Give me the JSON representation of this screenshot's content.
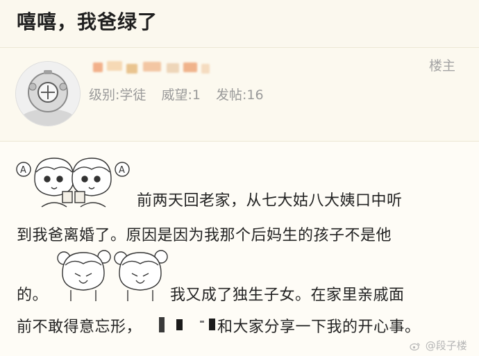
{
  "post": {
    "title": "嘻嘻，我爸绿了"
  },
  "author": {
    "level_label": "级别:学徒",
    "prestige_label": "威望:1",
    "posts_label": "发帖:16",
    "role_badge": "楼主",
    "extra": "-"
  },
  "content": {
    "line1": "前两天回老家，从七大姑八大姨口中听",
    "line2": "到我爸离婚了。原因是因为我那个后妈生的孩子不是他",
    "line3_start": "的。",
    "line3_end": "我又成了独生子女。在家里亲戚面",
    "line4_start": "前不敢得意忘形，",
    "line4_end": "和大家分享一下我的开心事。"
  },
  "watermark": {
    "text": "@段子楼"
  },
  "colors": {
    "background": "#fbf8ee",
    "content_bg": "#fefcf6",
    "meta_text": "#9a9a9a"
  },
  "icons": {
    "avatar": "diving-helmet-avatar-icon",
    "stickers": "twin-girls-sticker-icon",
    "watermark": "weibo-logo-icon"
  }
}
